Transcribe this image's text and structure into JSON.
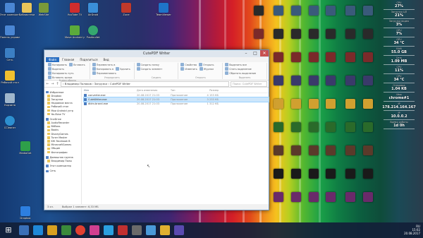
{
  "colors": {
    "accent": "#2a6fc2",
    "taskbar": "#122038"
  },
  "desktop": {
    "icons_left": [
      {
        "label": "Этот компьютер",
        "icon": "computer-icon",
        "color": "#4a86d4"
      },
      {
        "label": "Библиотеки",
        "icon": "folder-icon",
        "color": "#e8c55a"
      },
      {
        "label": "WebSite",
        "icon": "web-icon",
        "color": "#7a9a3a"
      },
      {
        "label": "YouTube TV",
        "icon": "tv-icon",
        "color": "#cf2d2d"
      },
      {
        "label": "AirDroid",
        "icon": "airdroid-icon",
        "color": "#3a8fd8"
      },
      {
        "label": "Zune",
        "icon": "zune-icon",
        "color": "#c0392b"
      },
      {
        "label": "TeamViewer",
        "icon": "teamviewer-icon",
        "color": "#1e73c8"
      }
    ],
    "icons_col": [
      {
        "label": "Панель управления",
        "icon": "control-panel-icon",
        "color": "#4a86d4"
      },
      {
        "label": "Сеть",
        "icon": "network-icon",
        "color": "#3b7fc4"
      },
      {
        "label": "Рабочий стол",
        "icon": "desktop-icon",
        "color": "#f0c030"
      },
      {
        "label": "Корзина",
        "icon": "recycle-bin-icon",
        "color": "#9fb6cc"
      },
      {
        "label": "CCleaner",
        "icon": "ccleaner-icon",
        "color": "#2d8fd0"
      },
      {
        "label": "MediaGet",
        "icon": "mediaget-icon",
        "color": "#2e9f4a"
      },
      {
        "label": "Dropbox",
        "icon": "dropbox-icon",
        "color": "#2d7fe0"
      }
    ],
    "icons_mid": [
      {
        "label": "Move Android устройства",
        "icon": "android-icon",
        "color": "#5bab3b"
      },
      {
        "label": "Pushbullet",
        "icon": "pushbullet-icon",
        "color": "#35a86f"
      }
    ]
  },
  "window": {
    "title": "CutePDF Writer",
    "tabs": [
      "Файл",
      "Главная",
      "Поделиться",
      "Вид"
    ],
    "ribbon": [
      {
        "caption": "Буфер обмена",
        "items": [
          "Копировать",
          "Вставить",
          "Вырезать",
          "Копировать путь",
          "Вставить ярлык"
        ]
      },
      {
        "caption": "Упорядочить",
        "items": [
          "Переместить в",
          "Копировать в",
          "Удалить",
          "Переименовать"
        ]
      },
      {
        "caption": "Создать",
        "items": [
          "Создать папку",
          "Создать элемент"
        ]
      },
      {
        "caption": "Открыть",
        "items": [
          "Свойства",
          "Открыть",
          "Изменить",
          "Журнал"
        ]
      },
      {
        "caption": "Выделить",
        "items": [
          "Выделить все",
          "Снять выделение",
          "Обратить выделение"
        ]
      }
    ],
    "breadcrumb": "› Владимир Поляков › Загрузки › CutePDF Writer",
    "search_placeholder": "Поиск: CutePDF Writer",
    "nav": [
      {
        "label": "Избранное",
        "header": true
      },
      {
        "label": "Dropbox"
      },
      {
        "label": "Загрузки"
      },
      {
        "label": "Недавние места"
      },
      {
        "label": "Рабочий стол"
      },
      {
        "label": "Мои Android устр"
      },
      {
        "label": "YouTube TV"
      },
      {
        "label": "OneDrive",
        "header": true
      },
      {
        "label": "AudioRecorder"
      },
      {
        "label": "BitBoss"
      },
      {
        "label": "Books"
      },
      {
        "label": "DisneyGames"
      },
      {
        "label": "Tuner Master"
      },
      {
        "label": "KHI Facebook B"
      },
      {
        "label": "MinecraftGames"
      },
      {
        "label": "Общие"
      },
      {
        "label": "Фотографии"
      },
      {
        "label": "Домашняя группа",
        "header": true
      },
      {
        "label": "Владимир Полы"
      },
      {
        "label": "Этот компьютер",
        "header": true
      },
      {
        "label": "Сеть",
        "header": true
      }
    ],
    "columns": [
      "Имя",
      "Дата изменения",
      "Тип",
      "Размер"
    ],
    "files": [
      {
        "name": "converter.exe",
        "date": "20.08.2017 21:03",
        "type": "Приложение",
        "size": "4 153 КБ",
        "selected": false
      },
      {
        "name": "CuteWriter.exe",
        "date": "20.08.2017 21:03",
        "type": "Приложение",
        "size": "3 233 КБ",
        "selected": true
      },
      {
        "name": "dldrv.brand.exe",
        "date": "20.08.2017 21:03",
        "type": "Приложение",
        "size": "1 312 КБ",
        "selected": false
      }
    ],
    "status_count": "3 эл.",
    "status_selected": "Выбран 1 элемент: 6,33 МБ"
  },
  "gadget": [
    {
      "label": "CPU",
      "value": "27%"
    },
    {
      "label": "Загрузка ЦП",
      "value": "21%"
    },
    {
      "label": "Загрузка видео",
      "value": "3%"
    },
    {
      "label": "GPU",
      "value": "7%"
    },
    {
      "label": "GPU",
      "value": "34 °C"
    },
    {
      "label": "RAM",
      "value": "55.0 GB"
    },
    {
      "label": "Сеть",
      "value": "1.09 MB"
    },
    {
      "label": "CPU",
      "value": "11%"
    },
    {
      "label": "CPU",
      "value": "34 °C"
    },
    {
      "label": "Отправка",
      "value": "1.04 KB"
    },
    {
      "label": "Имя",
      "value": "chrome#1"
    },
    {
      "label": "IP",
      "value": "178.214.164.167"
    },
    {
      "label": "IP",
      "value": "10.0.0.2"
    },
    {
      "label": "Время работы",
      "value": "1d 0h"
    }
  ],
  "tray": {
    "time": "15:02",
    "date": "20.08.2017",
    "lang": "RU"
  }
}
